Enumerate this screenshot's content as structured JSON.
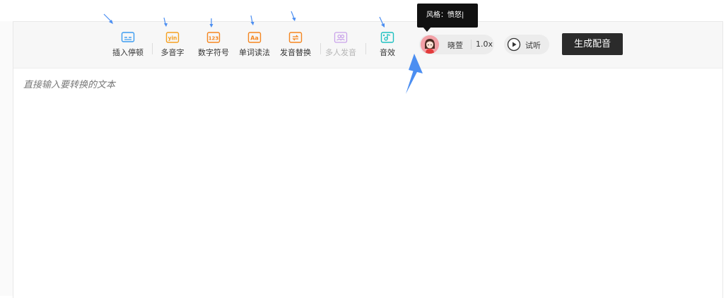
{
  "toolbar": {
    "items": [
      {
        "label": "插入停顿",
        "icon": "insert-pause-icon",
        "color": "#3b9cf0"
      },
      {
        "label": "多音字",
        "icon": "polyphone-icon",
        "color": "#f5a021"
      },
      {
        "label": "数字符号",
        "icon": "number-symbol-icon",
        "color": "#f5861f"
      },
      {
        "label": "单词读法",
        "icon": "word-reading-icon",
        "color": "#f5861f"
      },
      {
        "label": "发音替换",
        "icon": "pronunciation-replace-icon",
        "color": "#f5861f"
      },
      {
        "label": "多人发音",
        "icon": "multi-speaker-icon",
        "color": "#c9a2ea"
      },
      {
        "label": "音效",
        "icon": "sound-effect-icon",
        "color": "#1ec0c0"
      }
    ]
  },
  "voice": {
    "name": "晓萱",
    "speed": "1.0x",
    "avatar_icon": "female-avatar-icon"
  },
  "tooltip": {
    "text": "风格：愤怒|"
  },
  "preview": {
    "label": "试听",
    "icon": "play-icon"
  },
  "generate": {
    "label": "生成配音"
  },
  "editor": {
    "placeholder": "直接输入要转换的文本"
  },
  "colors": {
    "toolbar_bg": "#f7f7f7",
    "annotation_arrow": "#4b8ef1",
    "generate_bg": "#2b2b2b"
  }
}
